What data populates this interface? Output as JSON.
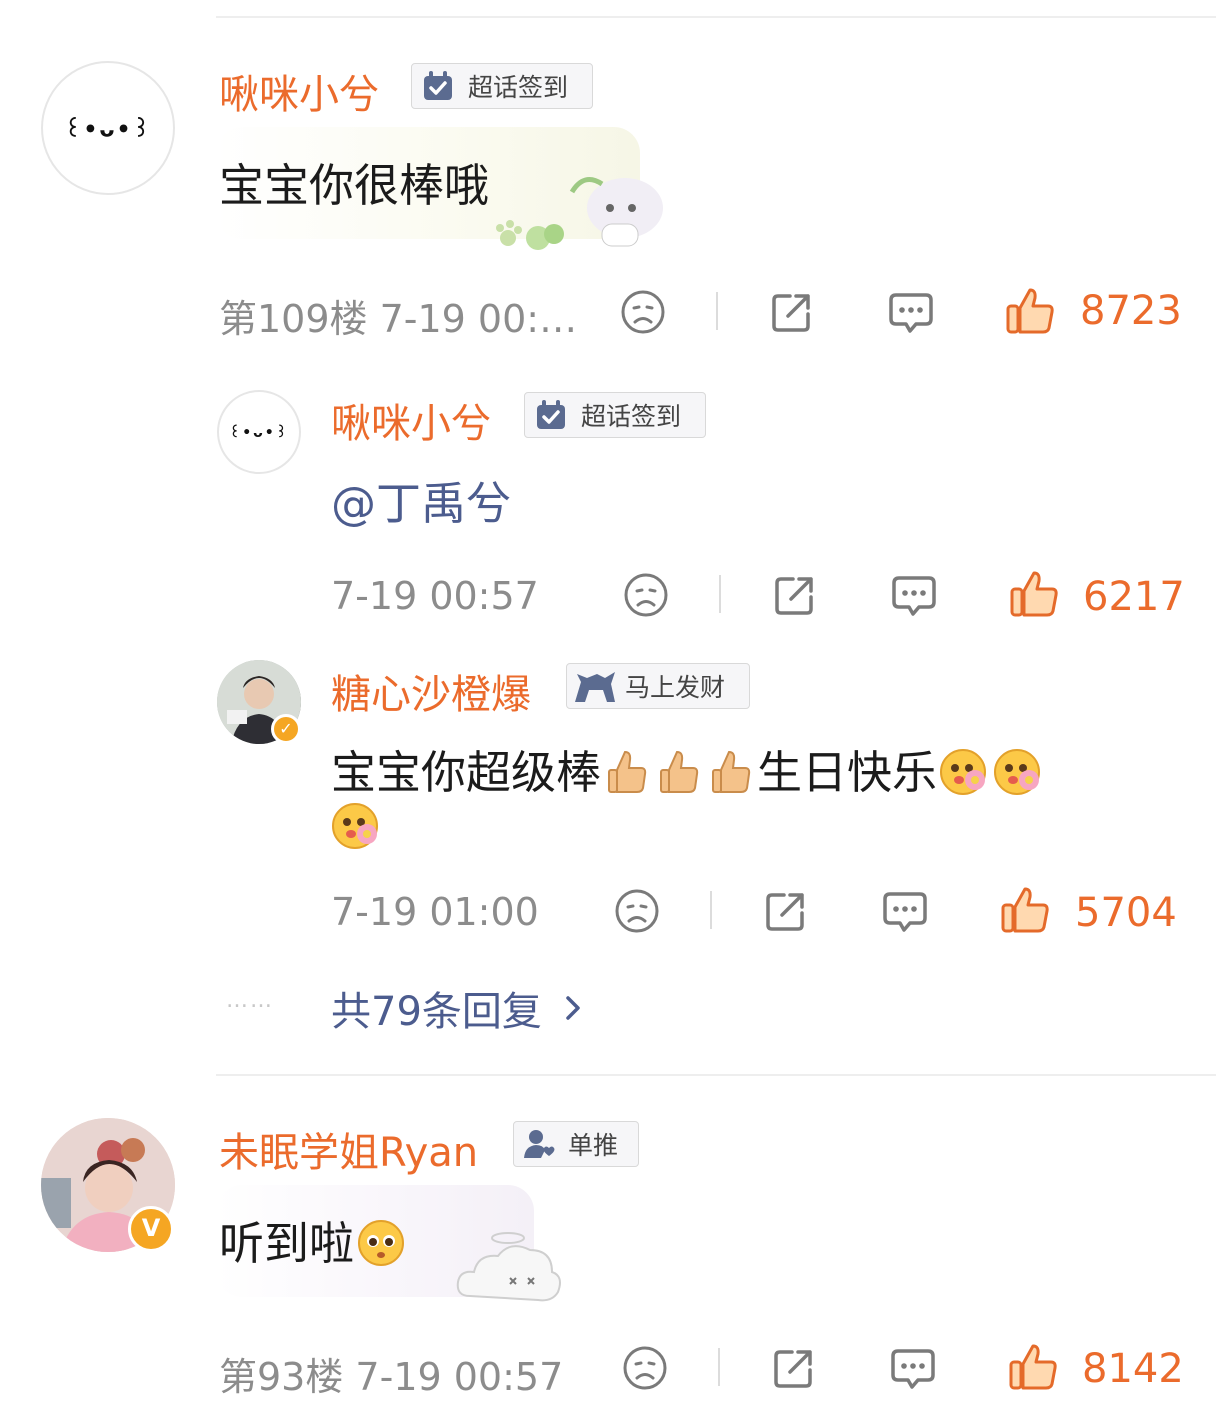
{
  "colors": {
    "accent": "#eb6b2c",
    "link": "#4c5c8e",
    "meta": "#8c8c8c"
  },
  "comments": [
    {
      "user": "啾咪小兮",
      "avatar_text": "꒰•ᴗ•꒱",
      "badge": {
        "icon": "calendar-check-icon",
        "label": "超话签到"
      },
      "text": "宝宝你很棒哦",
      "meta": "第109楼 7-19 00:…",
      "likes": "8723",
      "replies": [
        {
          "user": "啾咪小兮",
          "avatar_text": "꒰•ᴗ•꒱",
          "badge": {
            "icon": "calendar-check-icon",
            "label": "超话签到"
          },
          "text": "@丁禹兮",
          "meta": "7-19 00:57",
          "likes": "6217"
        },
        {
          "user": "糖心沙橙爆",
          "badge": {
            "icon": "horse-icon",
            "label": "马上发财"
          },
          "text": "宝宝你超级棒",
          "text_tail": "生日快乐",
          "meta": "7-19 01:00",
          "likes": "5704"
        }
      ],
      "more_dots": "……",
      "more_replies": "共79条回复"
    },
    {
      "user": "未眠学姐Ryan",
      "badge": {
        "icon": "person-heart-icon",
        "label": "单推"
      },
      "text": "听到啦",
      "meta": "第93楼 7-19 00:57",
      "likes": "8142"
    }
  ]
}
